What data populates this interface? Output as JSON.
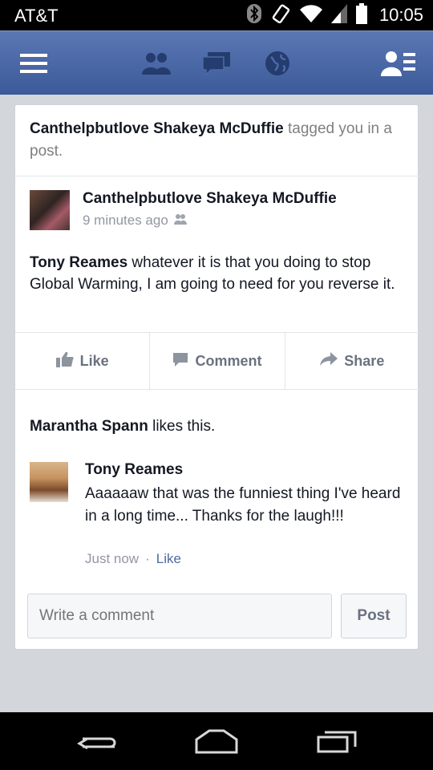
{
  "status_bar": {
    "carrier": "AT&T",
    "time": "10:05",
    "icons": [
      "bluetooth-icon",
      "vibrate-icon",
      "wifi-icon",
      "signal-icon",
      "battery-icon"
    ]
  },
  "nav": {
    "icons": [
      "menu-icon",
      "friend-requests-icon",
      "messages-icon",
      "notifications-globe-icon",
      "friends-list-icon"
    ],
    "colors": {
      "bar_top": "#5b77b4",
      "bar_bottom": "#3c5a99"
    }
  },
  "notice": {
    "author": "Canthelpbutlove Shakeya McDuffie",
    "text": " tagged you in a post."
  },
  "post": {
    "author": "Canthelpbutlove Shakeya McDuffie",
    "time": "9 minutes ago",
    "privacy_icon": "friends-icon",
    "tagged": "Tony Reames",
    "body": " whatever it is that you doing to stop Global Warming, I am going to need for you reverse it."
  },
  "actions": {
    "like": "Like",
    "comment": "Comment",
    "share": "Share"
  },
  "likes": {
    "name": "Marantha Spann",
    "text": " likes this."
  },
  "comment": {
    "author": "Tony Reames",
    "text": "Aaaaaaw that was the funniest thing I've heard in a long time... Thanks for the laugh!!!",
    "time": "Just now",
    "separator": "·",
    "like": "Like"
  },
  "composer": {
    "placeholder": "Write a comment",
    "post_label": "Post"
  },
  "system_nav": {
    "icons": [
      "back-icon",
      "home-icon",
      "recent-apps-icon"
    ]
  }
}
